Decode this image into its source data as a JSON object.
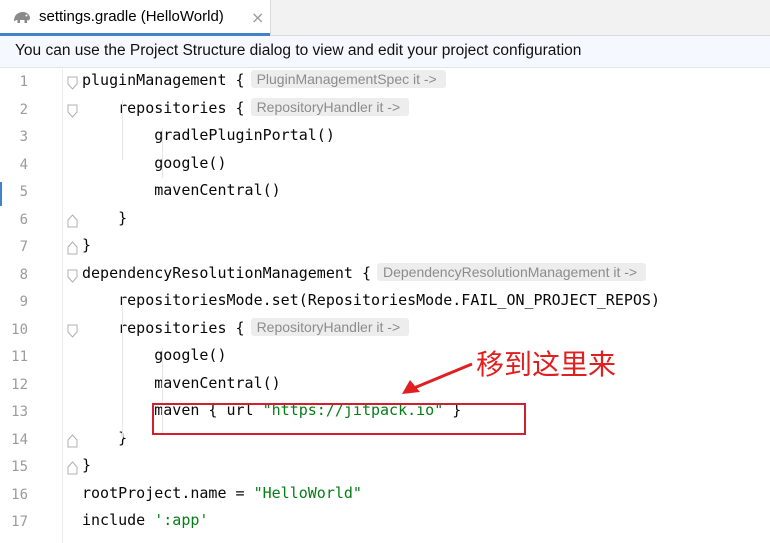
{
  "tab": {
    "title": "settings.gradle (HelloWorld)",
    "close": "×",
    "icon": "gradle-elephant-icon"
  },
  "notice": {
    "text": "You can use the Project Structure dialog to view and edit your project configuration"
  },
  "lines": [
    {
      "n": "1",
      "tokens": [
        {
          "t": "pluginManagement {"
        }
      ],
      "hint": "PluginManagementSpec it ->"
    },
    {
      "n": "2",
      "tokens": [
        {
          "t": "    repositories {"
        }
      ],
      "hint": "RepositoryHandler it ->"
    },
    {
      "n": "3",
      "tokens": [
        {
          "t": "        gradlePluginPortal()"
        }
      ]
    },
    {
      "n": "4",
      "tokens": [
        {
          "t": "        google()"
        }
      ]
    },
    {
      "n": "5",
      "tokens": [
        {
          "t": "        mavenCentral()"
        }
      ]
    },
    {
      "n": "6",
      "tokens": [
        {
          "t": "    }"
        }
      ]
    },
    {
      "n": "7",
      "tokens": [
        {
          "t": "}"
        }
      ]
    },
    {
      "n": "8",
      "tokens": [
        {
          "t": "dependencyResolutionManagement {"
        }
      ],
      "hint": "DependencyResolutionManagement it ->"
    },
    {
      "n": "9",
      "tokens": [
        {
          "t": "    repositoriesMode.set(RepositoriesMode.FAIL_ON_PROJECT_REPOS)"
        }
      ]
    },
    {
      "n": "10",
      "tokens": [
        {
          "t": "    repositories {"
        }
      ],
      "hint": "RepositoryHandler it ->"
    },
    {
      "n": "11",
      "tokens": [
        {
          "t": "        google()"
        }
      ]
    },
    {
      "n": "12",
      "tokens": [
        {
          "t": "        mavenCentral()"
        }
      ]
    },
    {
      "n": "13",
      "tokens": [
        {
          "t": "        maven { url "
        },
        {
          "t": "\"https://jitpack.io\"",
          "s": true
        },
        {
          "t": " }"
        }
      ]
    },
    {
      "n": "14",
      "tokens": [
        {
          "t": "    }"
        }
      ]
    },
    {
      "n": "15",
      "tokens": [
        {
          "t": "}"
        }
      ]
    },
    {
      "n": "16",
      "tokens": [
        {
          "t": "rootProject.name = "
        },
        {
          "t": "\"HelloWorld\"",
          "s": true
        }
      ]
    },
    {
      "n": "17",
      "tokens": [
        {
          "t": "include "
        },
        {
          "t": "':app'",
          "s": true
        }
      ]
    }
  ],
  "annotation": {
    "text": "移到这里来",
    "color": "#e02020"
  },
  "colors": {
    "string": "#067d17",
    "accent": "#4083c9",
    "highlight": "#d0202e"
  }
}
